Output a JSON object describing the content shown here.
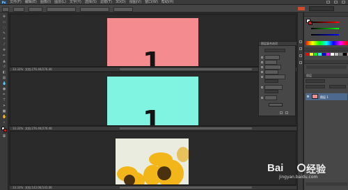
{
  "app": {
    "logo": "Ps"
  },
  "menubar": {
    "items": [
      "文件(F)",
      "编辑(E)",
      "图像(I)",
      "图层(L)",
      "文字(Y)",
      "选择(S)",
      "滤镜(T)",
      "3D(D)",
      "视图(V)",
      "窗口(W)",
      "帮助(H)"
    ]
  },
  "documents": [
    {
      "number": "1",
      "bg_color": "#f48b8e",
      "zoom": "33.33%",
      "info": "文档:276.4K/276.4K"
    },
    {
      "number": "1",
      "bg_color": "#80f4e0",
      "zoom": "33.33%",
      "info": "文档:276.4K/276.4K"
    },
    {
      "zoom": "33.33%",
      "info": "文档:143.0K/143.0K"
    }
  ],
  "layer_comp_panel": {
    "title": "图层复合选项"
  },
  "layers_panel": {
    "title": "图层",
    "layer_name": "图层 1"
  },
  "colors": {
    "bg": "#282828",
    "panel": "#474747",
    "accent_red": "#c02020",
    "selection_blue": "#4d6a8e",
    "swatches": [
      "#ff0000",
      "#ffff00",
      "#00ff00",
      "#00ffff",
      "#0000ff",
      "#ff00ff",
      "#ffffff",
      "#c0c0c0",
      "#808080",
      "#000000",
      "#f48b8e",
      "#80f4e0"
    ]
  },
  "watermark": {
    "brand": "Bai",
    "brand2": "经验",
    "url": "jingyan.baidu.com"
  }
}
